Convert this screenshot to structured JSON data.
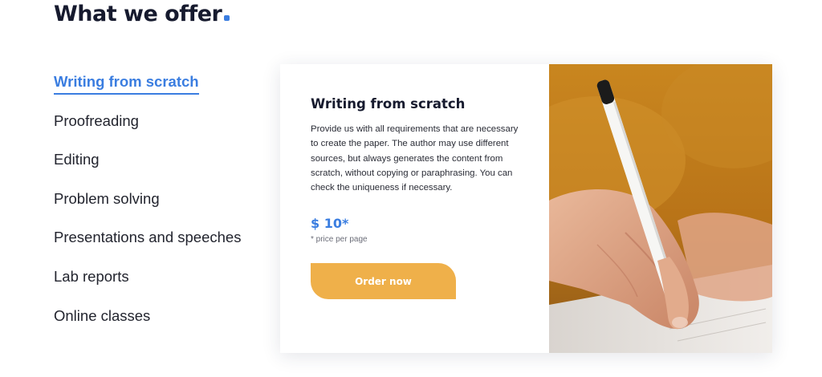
{
  "section": {
    "title": "What we offer"
  },
  "nav": {
    "items": [
      {
        "label": "Writing from scratch",
        "active": true
      },
      {
        "label": "Proofreading",
        "active": false
      },
      {
        "label": "Editing",
        "active": false
      },
      {
        "label": "Problem solving",
        "active": false
      },
      {
        "label": "Presentations and speeches",
        "active": false
      },
      {
        "label": "Lab reports",
        "active": false
      },
      {
        "label": "Online classes",
        "active": false
      }
    ]
  },
  "card": {
    "title": "Writing from scratch",
    "description": "Provide us with all requirements that are necessary to create the paper. The author may use different sources, but always generates the content from scratch, without copying or paraphrasing. You can check the uniqueness if necessary.",
    "price": "$ 10*",
    "price_note": "* price per page",
    "order_label": "Order now",
    "image_icon": "hand-writing-with-pen-photo"
  },
  "colors": {
    "accent": "#3a7de0",
    "button": "#efb04a",
    "title": "#161a2e",
    "text": "#22242e"
  }
}
